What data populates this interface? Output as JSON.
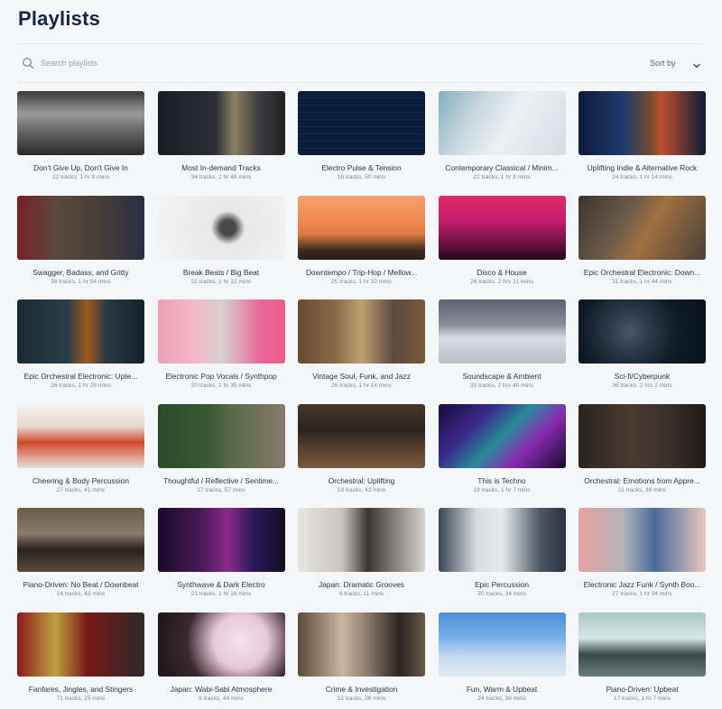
{
  "header": {
    "title": "Playlists"
  },
  "search": {
    "placeholder": "Search playlists",
    "value": ""
  },
  "sort": {
    "label": "Sort by"
  },
  "playlists": [
    {
      "title": "Don't Give Up, Don't Give In",
      "meta": "22 tracks, 1 hr 9 mins",
      "image": "muscular-man-pull-up-bw",
      "bg": "linear-gradient(180deg,#3a3a3a 0%,#9a9a9a 35%,#6a6a6a 60%,#2a2a2a 100%)"
    },
    {
      "title": "Most In-demand Tracks",
      "meta": "34 tracks, 1 hr 48 mins",
      "image": "netflix-dark-interface",
      "bg": "linear-gradient(90deg,#1a1c22 0%,#2b2e36 45%,#8a8060 60%,#3a3a40 80%,#222 100%)"
    },
    {
      "title": "Electro Pulse & Tension",
      "meta": "16 tracks, 50 mins",
      "image": "blue-waveform-grid",
      "bg": "repeating-linear-gradient(0deg,#0b1d3a 0px,#0b1d3a 7px,#1a3a6a 8px),linear-gradient(#0a1830,#0a1830)"
    },
    {
      "title": "Contemporary Classical / Minim...",
      "meta": "22 tracks, 1 hr 8 mins",
      "image": "white-architecture",
      "bg": "linear-gradient(120deg,#7fb0c0 0%,#c8d8de 30%,#eef0f3 55%,#d7dbe2 100%)"
    },
    {
      "title": "Uplifting Indie & Alternative Rock",
      "meta": "24 tracks, 1 hr 14 mins",
      "image": "guitarist-on-stage",
      "bg": "linear-gradient(90deg,#0d1a3a 0%,#1f3a6e 35%,#6a4a30 55%,#c05030 65%,#0e1a35 100%)"
    },
    {
      "title": "Swagger, Badass, and Gritty",
      "meta": "38 tracks, 1 hr 54 mins",
      "image": "muscular-man-flag",
      "bg": "linear-gradient(90deg,#7a1e22 0%,#5a4a40 30%,#4a4038 60%,#2a2e44 100%)"
    },
    {
      "title": "Break Beats / Big Beat",
      "meta": "22 tracks, 1 hr 12 mins",
      "image": "breakdancer-white",
      "bg": "radial-gradient(circle at 55% 50%,#4a4a4a 0%,#4a4a4a 10%,#e8e8e8 22%,#f4f4f4 100%)"
    },
    {
      "title": "Downtempo / Trip-Hop / Mellow...",
      "meta": "25 tracks, 1 hr 32 mins",
      "image": "sunset-silhouette",
      "bg": "linear-gradient(180deg,#f5a070 0%,#f08a50 40%,#e07a40 60%,#3a2a20 85%,#2a1e18 100%)"
    },
    {
      "title": "Disco & House",
      "meta": "26 tracks, 2 hrs 11 mins",
      "image": "concert-lights-pink",
      "bg": "linear-gradient(180deg,#e02a6a 0%,#c01e70 40%,#6a1040 75%,#200818 100%)"
    },
    {
      "title": "Epic Orchestral Electronic: Down...",
      "meta": "31 tracks, 1 hr 44 mins",
      "image": "warrior-eagle-fire",
      "bg": "linear-gradient(120deg,#3a3430 0%,#6a5a4a 35%,#a07040 55%,#4a4038 100%)"
    },
    {
      "title": "Epic Orchestral Electronic: Upte...",
      "meta": "26 tracks, 1 hr 28 mins",
      "image": "dark-city-street",
      "bg": "linear-gradient(90deg,#1a2a34 0%,#2a3e48 40%,#a05a20 55%,#2a3a44 70%,#14202a 100%)"
    },
    {
      "title": "Electronic Pop Vocals / Synthpop",
      "meta": "20 tracks, 1 hr 35 mins",
      "image": "headphones-pink",
      "bg": "linear-gradient(90deg,#f0a0b8 0%,#f5b8c8 30%,#d8d0d0 50%,#e86a9a 80%,#f05a8a 100%)"
    },
    {
      "title": "Vintage Soul, Funk, and Jazz",
      "meta": "26 tracks, 1 hr 14 mins",
      "image": "retro-group",
      "bg": "linear-gradient(90deg,#6a4a30 0%,#8a6a48 30%,#c0a070 50%,#5a4a40 75%,#7a5a3a 100%)"
    },
    {
      "title": "Soundscape & Ambient",
      "meta": "33 tracks, 2 hrs 40 mins",
      "image": "snowy-mountains",
      "bg": "linear-gradient(180deg,#5a6070 0%,#8a909c 40%,#d8dce2 60%,#b8bcc4 100%)"
    },
    {
      "title": "Sci-fi/Cyberpunk",
      "meta": "36 tracks, 2 hrs 2 mins",
      "image": "astronaut-helmet",
      "bg": "radial-gradient(circle at 40% 50%,#4a5868 0%,#2a3a48 25%,#0e1a26 60%,#08121c 100%)"
    },
    {
      "title": "Cheering & Body Percussion",
      "meta": "27 tracks, 41 mins",
      "image": "cheerleaders",
      "bg": "linear-gradient(180deg,#f4f4f4 0%,#e8d8d0 35%,#d04a2a 60%,#e8e0d8 100%)"
    },
    {
      "title": "Thoughtful / Reflective / Sentime...",
      "meta": "17 tracks, 57 mins",
      "image": "woman-forest",
      "bg": "linear-gradient(90deg,#2a4a2a 0%,#3a5a34 40%,#5a6a4a 60%,#8a7a6a 100%)"
    },
    {
      "title": "Orchestral: Uplifting",
      "meta": "19 tracks, 43 mins",
      "image": "orchestra-hall",
      "bg": "linear-gradient(180deg,#4a3828 0%,#2a2420 40%,#5a4030 70%,#7a5a3a 100%)"
    },
    {
      "title": "This is Techno",
      "meta": "19 tracks, 1 hr 7 mins",
      "image": "laser-show",
      "bg": "linear-gradient(135deg,#1a0a3a 0%,#3a2a8a 30%,#2a8a9a 50%,#8a2ab0 70%,#140a2a 100%)"
    },
    {
      "title": "Orchestral: Emotions from Appre...",
      "meta": "11 tracks, 38 mins",
      "image": "chamber-musicians",
      "bg": "linear-gradient(90deg,#2a2420 0%,#4a3a30 40%,#3a302a 70%,#1e1a18 100%)"
    },
    {
      "title": "Piano-Driven: No Beat / Downbeat",
      "meta": "14 tracks, 43 mins",
      "image": "grand-piano-room",
      "bg": "linear-gradient(180deg,#6a5a4a 0%,#8a7a6a 40%,#2a2420 65%,#5a4a3a 100%)"
    },
    {
      "title": "Synthwave & Dark Electro",
      "meta": "21 tracks, 1 hr 18 mins",
      "image": "neon-street-figure",
      "bg": "linear-gradient(90deg,#1a0a2a 0%,#4a1a5a 35%,#8a2a8a 55%,#2a1a5a 75%,#120a20 100%)"
    },
    {
      "title": "Japan: Dramatic Grooves",
      "meta": "6 tracks, 11 mins",
      "image": "samurai-sword",
      "bg": "linear-gradient(90deg,#e8e6e2 0%,#c8c4be 35%,#3a3634 55%,#d8d4d0 100%)"
    },
    {
      "title": "Epic Percussion",
      "meta": "20 tracks, 34 mins",
      "image": "bass-drum",
      "bg": "linear-gradient(90deg,#3a4654 0%,#d8dce0 30%,#e8eaec 50%,#4a5664 80%,#2a3440 100%)"
    },
    {
      "title": "Electronic Jazz Funk / Synth Boo...",
      "meta": "27 tracks, 1 hr 34 mins",
      "image": "boombox-dancers",
      "bg": "linear-gradient(90deg,#e8a0a0 0%,#b0b4b8 35%,#4a6a9a 60%,#e8c8c0 100%)"
    },
    {
      "title": "Fanfares, Jingles, and Stingers",
      "meta": "71 tracks, 15 mins",
      "image": "brass-band",
      "bg": "linear-gradient(90deg,#8a1a1a 0%,#c0a040 30%,#7a1818 55%,#2a2a2a 100%)"
    },
    {
      "title": "Japan: Wabi-Sabi Atmosphere",
      "meta": "9 tracks, 44 mins",
      "image": "cherry-blossoms",
      "bg": "radial-gradient(circle at 65% 45%,#f4e4ec 0%,#e8c8d8 30%,#3a2a30 60%,#1a1418 100%)"
    },
    {
      "title": "Crime & Investigation",
      "meta": "12 tracks, 36 mins",
      "image": "detective-board",
      "bg": "linear-gradient(90deg,#5a4a3a 0%,#c8b8a0 35%,#8a7a6a 55%,#2a2420 80%,#6a5a4a 100%)"
    },
    {
      "title": "Fun, Warm & Upbeat",
      "meta": "24 tracks, 36 mins",
      "image": "jumping-man-sky",
      "bg": "linear-gradient(180deg,#4a90d8 0%,#7ab0e8 40%,#c8dcf0 70%,#e0e8f0 100%)"
    },
    {
      "title": "Piano-Driven: Upbeat",
      "meta": "17 tracks, 1 hr 7 mins",
      "image": "piano-window",
      "bg": "linear-gradient(180deg,#a8c8c0 0%,#d8e8e4 40%,#3a4a48 65%,#6a7a78 100%)"
    }
  ]
}
